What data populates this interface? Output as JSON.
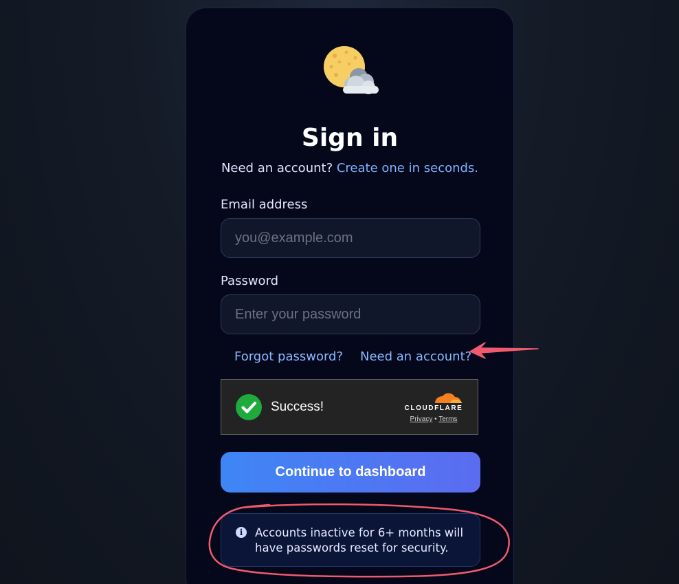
{
  "colors": {
    "accent_link": "#8ab8ff",
    "primary_gradient_start": "#3e86f6",
    "primary_gradient_end": "#5b6cf0",
    "card_background": "#05081a",
    "annotation_red": "#f05a6e",
    "success_green": "#1faa3e",
    "cloudflare_orange": "#f48120"
  },
  "logo": {
    "icon": "moon-behind-cloud-icon"
  },
  "header": {
    "title": "Sign in",
    "subtitle_prefix": "Need an account?",
    "subtitle_link": "Create one in seconds."
  },
  "form": {
    "email": {
      "label": "Email address",
      "placeholder": "you@example.com",
      "value": ""
    },
    "password": {
      "label": "Password",
      "placeholder": "Enter your password",
      "value": ""
    },
    "forgot_link": "Forgot password?",
    "need_account_link": "Need an account?"
  },
  "captcha": {
    "status_icon": "checkmark-circle-icon",
    "status_text": "Success!",
    "brand": "CLOUDFLARE",
    "brand_icon": "cloudflare-cloud-icon",
    "privacy_link": "Privacy",
    "separator": "•",
    "terms_link": "Terms"
  },
  "primary_button": {
    "label": "Continue to dashboard"
  },
  "notice": {
    "icon": "info-icon",
    "icon_glyph": "i",
    "text": "Accounts inactive for 6+ months will have passwords reset for security."
  },
  "annotations": {
    "arrow": "red-arrow-pointing-left",
    "circle": "red-hand-drawn-ellipse"
  }
}
